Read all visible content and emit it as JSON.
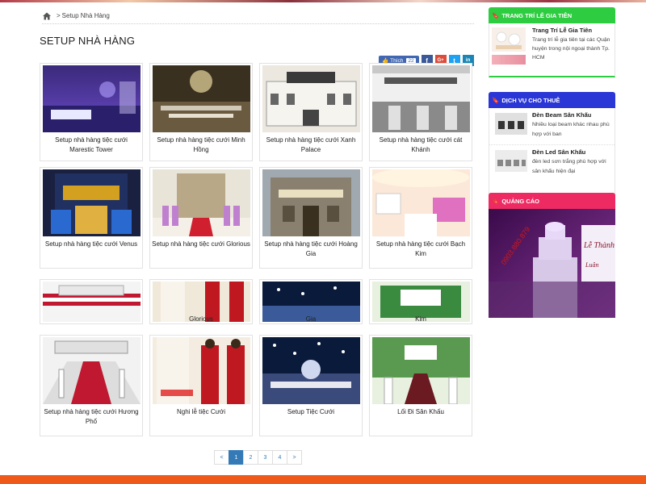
{
  "breadcrumb": {
    "home_icon": "home-icon",
    "separator": ">",
    "current": "Setup Nhà Hàng"
  },
  "page_title": "SETUP NHÀ HÀNG",
  "social": {
    "like_label": "Thích",
    "like_count": "22",
    "share_buttons": [
      "f",
      "G+",
      "t",
      "in"
    ]
  },
  "cards": [
    {
      "caption": "Setup nhà hàng tiệc cưới Marestic Tower"
    },
    {
      "caption": "Setup nhà hàng tiệc cưới Minh Hồng"
    },
    {
      "caption": "Setup nhà hàng tiệc cưới Xanh Palace"
    },
    {
      "caption": "Setup nhà hàng tiệc cưới cát Khánh"
    },
    {
      "caption": "Setup nhà hàng tiệc cưới Venus"
    },
    {
      "caption": "Setup nhà hàng tiệc cưới Glorious"
    },
    {
      "caption": "Setup nhà hàng tiệc cưới Hoàng Gia"
    },
    {
      "caption": "Setup nhà hàng tiệc cưới Bạch Kim"
    },
    {
      "caption": "Setup nhà hàng tiệc cưới Hương Phố"
    },
    {
      "caption": "Nghi lễ tiệc Cưới"
    },
    {
      "caption": "Setup Tiệc Cưới"
    },
    {
      "caption": "Lối Đi Sân Khấu"
    }
  ],
  "overlap_row": {
    "captions": [
      "Glorious",
      "Gia",
      "Kim"
    ]
  },
  "pagination": {
    "prev": "<",
    "pages": [
      "1",
      "2",
      "3",
      "4"
    ],
    "active": "1",
    "next": ">"
  },
  "sidebar": {
    "widget1": {
      "title": "TRANG TRÍ LỄ GIA TIÊN",
      "color": "#2ecc40",
      "item": {
        "name": "Trang Trí Lễ Gia Tiên",
        "desc": "Trang trí lễ gia tiên tại các Quận huyện trong nội ngoại thành Tp. HCM"
      }
    },
    "widget2": {
      "title": "DỊCH VỤ CHO THUÊ",
      "color": "#2a36d6",
      "items": [
        {
          "name": "Đèn Beam Sân Khấu",
          "desc": "Nhiều loại beam khác nhau phù hợp với ban"
        },
        {
          "name": "Đèn Led Sân Khấu",
          "desc": "đèn led sơn trắng phù hợp với sân khấu hiện đại"
        }
      ]
    },
    "widget3": {
      "title": "QUẢNG CÁO",
      "color": "#ee2a62",
      "ad_text": {
        "phone": "0903.880.879",
        "sign_line1": "Lễ Thành",
        "sign_line2": "Luân"
      }
    }
  },
  "colors": {
    "accent": "#337ab7",
    "footer": "#ef5a1a"
  }
}
